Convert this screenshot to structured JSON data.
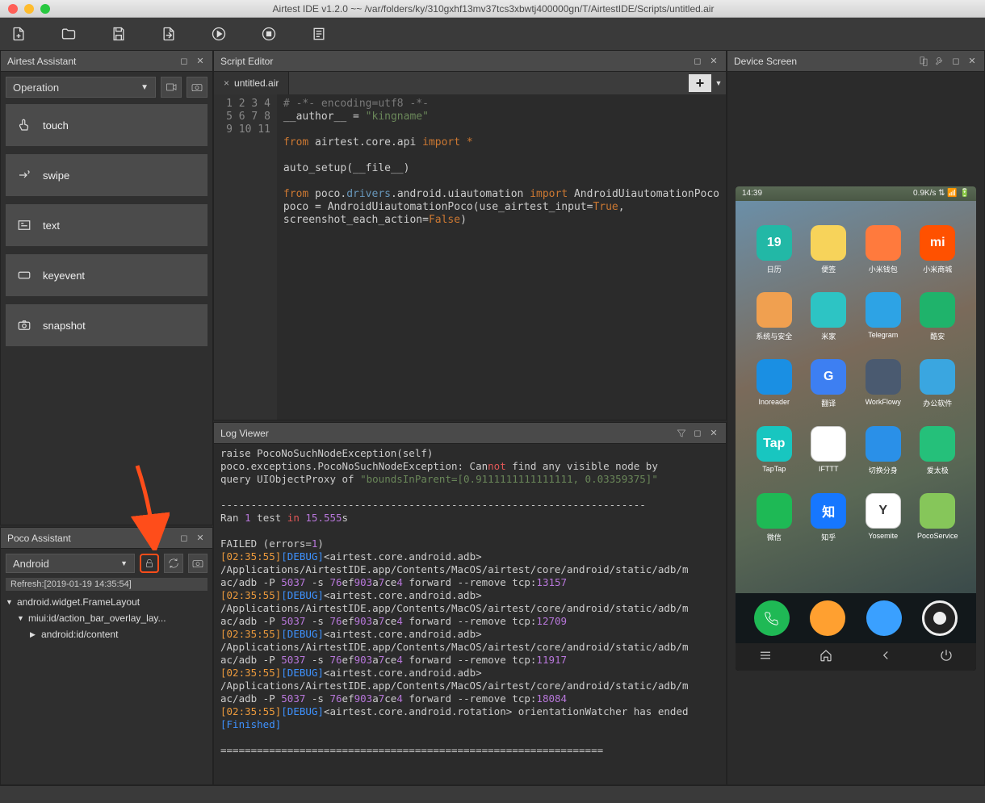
{
  "window": {
    "title": "Airtest IDE v1.2.0 ~~  /var/folders/ky/310gxhf13mv37tcs3xbwtj400000gn/T/AirtestIDE/Scripts/untitled.air"
  },
  "airtest_assistant": {
    "title": "Airtest Assistant",
    "operation_label": "Operation",
    "buttons": [
      {
        "id": "touch",
        "label": "touch"
      },
      {
        "id": "swipe",
        "label": "swipe"
      },
      {
        "id": "text",
        "label": "text"
      },
      {
        "id": "keyevent",
        "label": "keyevent"
      },
      {
        "id": "snapshot",
        "label": "snapshot"
      }
    ]
  },
  "poco_assistant": {
    "title": "Poco Assistant",
    "platform_label": "Android",
    "refresh_label": "Refresh:[2019-01-19 14:35:54]",
    "tree": {
      "root": "android.widget.FrameLayout",
      "child1": "miui:id/action_bar_overlay_lay...",
      "child2": "android:id/content"
    }
  },
  "script_editor": {
    "title": "Script Editor",
    "tab": "untitled.air",
    "line_count": 11,
    "code": {
      "l1a": "# -*- encoding=utf8 -*-",
      "l2a": "__author__ = ",
      "l2b": "\"kingname\"",
      "l4a": "from",
      "l4b": " airtest.core.api ",
      "l4c": "import",
      "l4d": " *",
      "l6a": "auto_setup(__file__)",
      "l8a": "from",
      "l8b": " poco.",
      "l8c": "drivers",
      "l8d": ".android.uiautomation ",
      "l8e": "import",
      "l8f": " AndroidUiautomationPoco",
      "l9a": "poco = AndroidUiautomationPoco(use_airtest_input=",
      "l9b": "True",
      "l9c": ",",
      "l10a": "screenshot_each_action=",
      "l10b": "False",
      "l10c": ")"
    }
  },
  "log_viewer": {
    "title": "Log Viewer",
    "lines": {
      "a": "    raise PocoNoSuchNodeException(self)",
      "b1": "poco.exceptions.PocoNoSuchNodeException: Can",
      "b2": "not",
      "b3": " find any visible node by",
      "c1": "query UIObjectProxy of ",
      "c2": "\"boundsInParent=[0.9111111111111111, 0.03359375]\"",
      "dash": "----------------------------------------------------------------------",
      "r1": "Ran ",
      "r2": "1",
      "r3": " test ",
      "r4": "in",
      "r5": " ",
      "r6": "15.555",
      "r7": "s",
      "f1": "FAILED (errors=",
      "f2": "1",
      "f3": ")",
      "t1": "[02:35:55]",
      "lv": "[DEBUG]",
      "adb": "<airtest.core.android.adb>",
      "p1": "/Applications/AirtestIDE.app/Contents/MacOS/airtest/core/android/static/adb/m",
      "p2a": "ac/adb -P ",
      "p2b": "5037",
      "p2c": " -s ",
      "p2d": "76",
      "p2e": "ef",
      "p2f": "903",
      "p2g": "a",
      "p2h": "7",
      "p2i": "ce",
      "p2j": "4",
      "p2k": " forward --remove tcp:",
      "port1": "13157",
      "port2": "12709",
      "port3": "11917",
      "port4": "18084",
      "rot": "<airtest.core.android.rotation> orientationWatcher has ended",
      "fin": "[Finished]",
      "eq": "==============================================================="
    }
  },
  "device_screen": {
    "title": "Device Screen",
    "status_time": "14:39",
    "status_right": "0.9K/s",
    "apps": [
      {
        "label": "日历",
        "color": "#22b8a6",
        "text": "19"
      },
      {
        "label": "便签",
        "color": "#f7d35a",
        "text": ""
      },
      {
        "label": "小米钱包",
        "color": "#ff7a3d",
        "text": ""
      },
      {
        "label": "小米商城",
        "color": "#ff5100",
        "text": "mi"
      },
      {
        "label": "系统与安全",
        "color": "#f0a050",
        "text": ""
      },
      {
        "label": "米家",
        "color": "#2dc4c4",
        "text": ""
      },
      {
        "label": "Telegram",
        "color": "#2da3e5",
        "text": ""
      },
      {
        "label": "酷安",
        "color": "#1fb36b",
        "text": ""
      },
      {
        "label": "Inoreader",
        "color": "#1a8fe3",
        "text": ""
      },
      {
        "label": "翻译",
        "color": "#3d7ff2",
        "text": "G"
      },
      {
        "label": "WorkFlowy",
        "color": "#4a5a70",
        "text": ""
      },
      {
        "label": "办公软件",
        "color": "#3aa6e0",
        "text": ""
      },
      {
        "label": "TapTap",
        "color": "#18c6c0",
        "text": "Tap"
      },
      {
        "label": "IFTTT",
        "color": "#ffffff",
        "text": ""
      },
      {
        "label": "切换分身",
        "color": "#2a90e8",
        "text": ""
      },
      {
        "label": "爱太极",
        "color": "#25c07a",
        "text": ""
      },
      {
        "label": "微信",
        "color": "#1eb955",
        "text": ""
      },
      {
        "label": "知乎",
        "color": "#1677ff",
        "text": "知"
      },
      {
        "label": "Yosemite",
        "color": "#ffffff",
        "text": "Y"
      },
      {
        "label": "PocoService",
        "color": "#86c65a",
        "text": ""
      }
    ]
  }
}
